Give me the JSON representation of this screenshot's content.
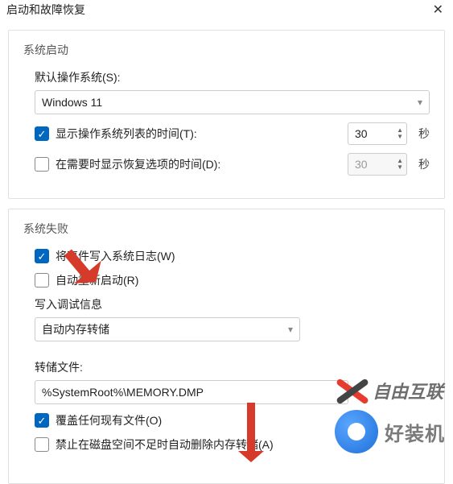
{
  "title": "启动和故障恢复",
  "close": "✕",
  "section1": {
    "heading": "系统启动",
    "default_os_label": "默认操作系统(S):",
    "default_os_value": "Windows 11",
    "show_os_list": {
      "label": "显示操作系统列表的时间(T):",
      "checked": true,
      "seconds": "30",
      "unit": "秒"
    },
    "show_recovery": {
      "label": "在需要时显示恢复选项的时间(D):",
      "checked": false,
      "seconds": "30",
      "unit": "秒"
    }
  },
  "section2": {
    "heading": "系统失败",
    "write_event": {
      "label": "将事件写入系统日志(W)",
      "checked": true
    },
    "auto_restart": {
      "label": "自动重新启动(R)",
      "checked": false
    },
    "debug_info_label": "写入调试信息",
    "debug_info_value": "自动内存转储",
    "dump_file_label": "转储文件:",
    "dump_file_value": "%SystemRoot%\\MEMORY.DMP",
    "overwrite": {
      "label": "覆盖任何现有文件(O)",
      "checked": true
    },
    "no_delete": {
      "label": "禁止在磁盘空间不足时自动删除内存转储(A)",
      "checked": false
    }
  },
  "watermarks": {
    "wm1": "自由互联",
    "wm2": "好装机"
  }
}
